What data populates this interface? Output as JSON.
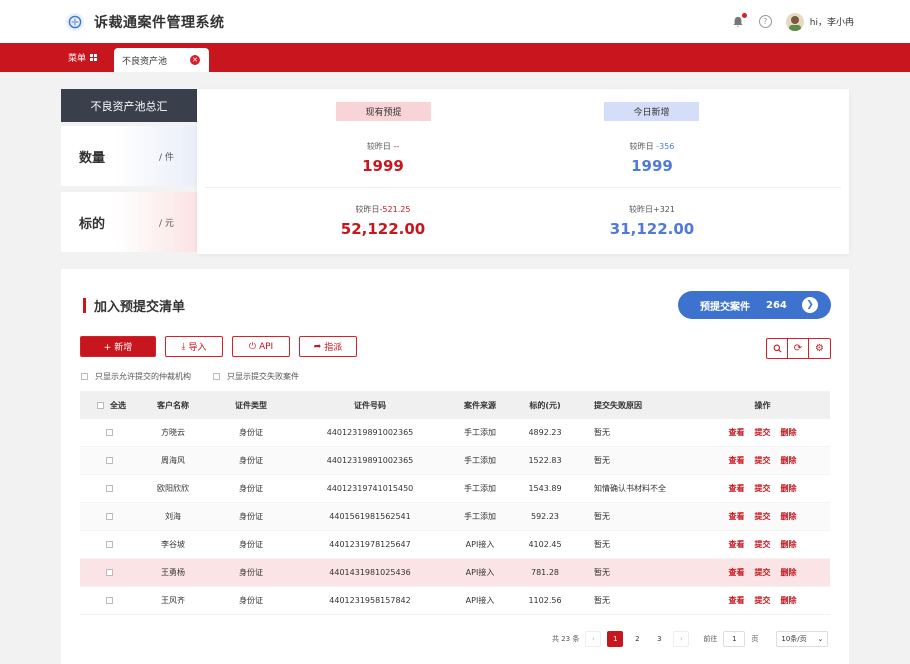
{
  "header": {
    "title": "诉裁通案件管理系统",
    "user_name": "hi，李小冉"
  },
  "tabbar": {
    "menu_label": "菜单",
    "active_tab": "不良资产池"
  },
  "summary": {
    "label": "不良资产池总汇",
    "metrics": [
      {
        "name": "数量",
        "unit": "/ 件"
      },
      {
        "name": "标的",
        "unit": "/ 元"
      }
    ],
    "columns": [
      {
        "header": "现有预提"
      },
      {
        "header": "今日新增"
      }
    ],
    "count_existing": {
      "compare_label": "较昨日",
      "compare_value": "--",
      "value": "1999"
    },
    "count_new": {
      "compare_label": "较昨日",
      "compare_value": "-356",
      "value": "1999"
    },
    "amount_existing": {
      "compare_label": "较昨日",
      "compare_value": "-521.25",
      "value": "52,122.00"
    },
    "amount_new": {
      "compare_label": "较昨日",
      "compare_value": "+321",
      "value": "31,122.00"
    },
    "colors": {
      "red": "#c8161e",
      "blue": "#4f7ad8"
    }
  },
  "panel": {
    "title": "加入预提交清单",
    "precommit": {
      "label": "预提交案件",
      "count": "264"
    },
    "toolbar": {
      "new_label": "+ 新增",
      "import_label": "导入",
      "api_label": "API",
      "assign_label": "指派"
    },
    "filters": [
      "只显示允许提交的仲裁机构",
      "只显示提交失败案件"
    ],
    "table": {
      "headers": {
        "select_all": "全选",
        "name": "客户名称",
        "id_type": "证件类型",
        "id_no": "证件号码",
        "source": "案件来源",
        "amount": "标的(元)",
        "reason": "提交失败原因",
        "ops": "操作"
      },
      "op_labels": {
        "view": "查看",
        "submit": "提交",
        "delete": "删除"
      },
      "rows": [
        {
          "name": "方晓云",
          "id_type": "身份证",
          "id_no": "44012319891002365",
          "source": "手工添加",
          "amount": "4892.23",
          "reason": "暂无"
        },
        {
          "name": "周海风",
          "id_type": "身份证",
          "id_no": "44012319891002365",
          "source": "手工添加",
          "amount": "1522.83",
          "reason": "暂无"
        },
        {
          "name": "欧阳欣欣",
          "id_type": "身份证",
          "id_no": "44012319741015450",
          "source": "手工添加",
          "amount": "1543.89",
          "reason": "知情确认书材料不全"
        },
        {
          "name": "刘海",
          "id_type": "身份证",
          "id_no": "4401561981562541",
          "source": "手工添加",
          "amount": "592.23",
          "reason": "暂无"
        },
        {
          "name": "李谷坡",
          "id_type": "身份证",
          "id_no": "4401231978125647",
          "source": "API接入",
          "amount": "4102.45",
          "reason": "暂无"
        },
        {
          "name": "王勇杨",
          "id_type": "身份证",
          "id_no": "4401431981025436",
          "source": "API接入",
          "amount": "781.28",
          "reason": "暂无"
        },
        {
          "name": "王风齐",
          "id_type": "身份证",
          "id_no": "4401231958157842",
          "source": "API接入",
          "amount": "1102.56",
          "reason": "暂无"
        }
      ]
    },
    "pager": {
      "total": "共 23 条",
      "pages": [
        "1",
        "2",
        "3"
      ],
      "goto_label": "前往",
      "goto_value": "1",
      "page_suffix": "页",
      "page_size": "10条/页"
    }
  }
}
